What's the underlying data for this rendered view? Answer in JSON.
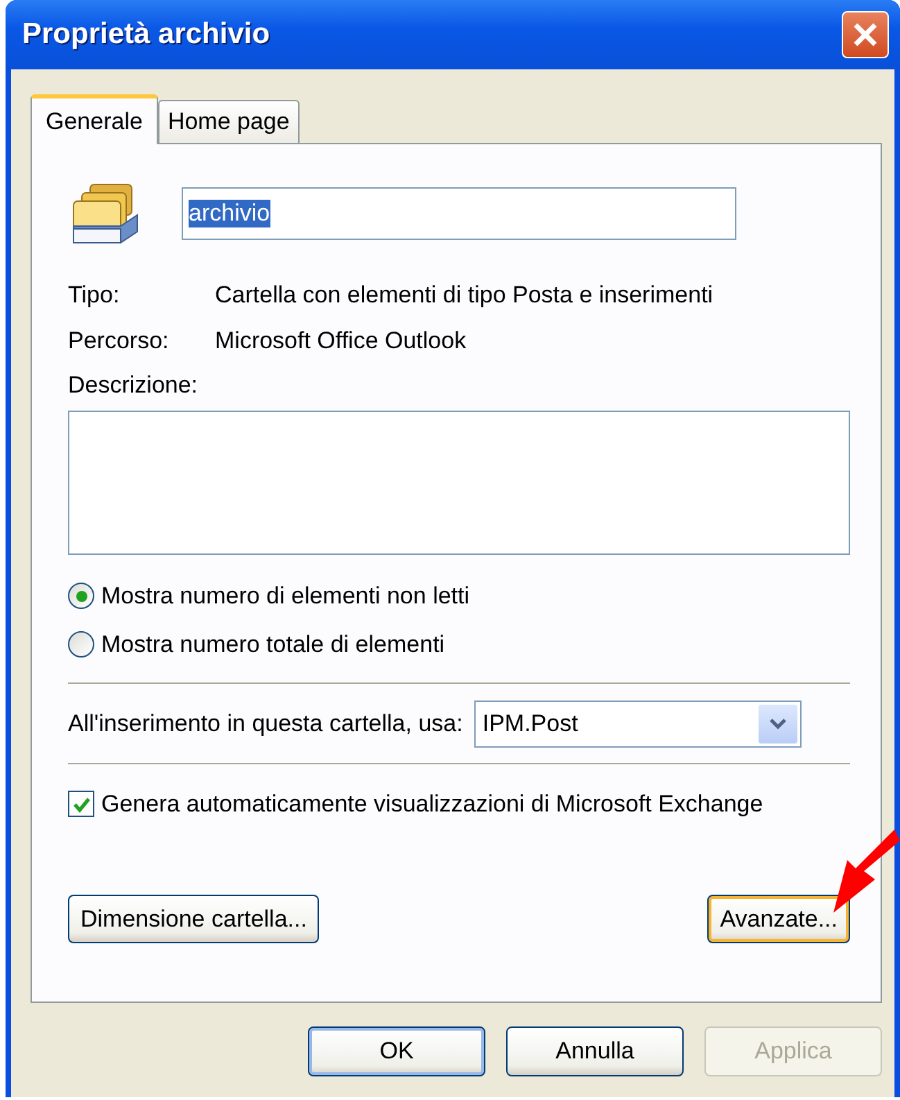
{
  "window": {
    "title": "Proprietà archivio"
  },
  "tabs": [
    {
      "label": "Generale",
      "selected": true
    },
    {
      "label": "Home page",
      "selected": false
    }
  ],
  "name_field": {
    "value": "archivio",
    "highlighted": true
  },
  "properties": [
    {
      "label": "Tipo:",
      "value": "Cartella con elementi di tipo Posta e inserimenti"
    },
    {
      "label": "Percorso:",
      "value": "Microsoft Office Outlook"
    }
  ],
  "description": {
    "label": "Descrizione:"
  },
  "radios": [
    {
      "label": "Mostra numero di elementi non letti",
      "selected": true
    },
    {
      "label": "Mostra numero totale di elementi",
      "selected": false
    }
  ],
  "post_form": {
    "label": "All'inserimento in questa cartella, usa:",
    "value": "IPM.Post"
  },
  "checkbox": {
    "label": "Genera automaticamente visualizzazioni di Microsoft Exchange",
    "checked": true
  },
  "panel_buttons": [
    {
      "label": "Dimensione cartella...",
      "focused": false
    },
    {
      "label": "Avanzate...",
      "focused": true
    }
  ],
  "dialog_buttons": [
    {
      "label": "OK",
      "default": true,
      "disabled": false
    },
    {
      "label": "Annulla",
      "default": false,
      "disabled": false
    },
    {
      "label": "Applica",
      "default": false,
      "disabled": true
    }
  ]
}
